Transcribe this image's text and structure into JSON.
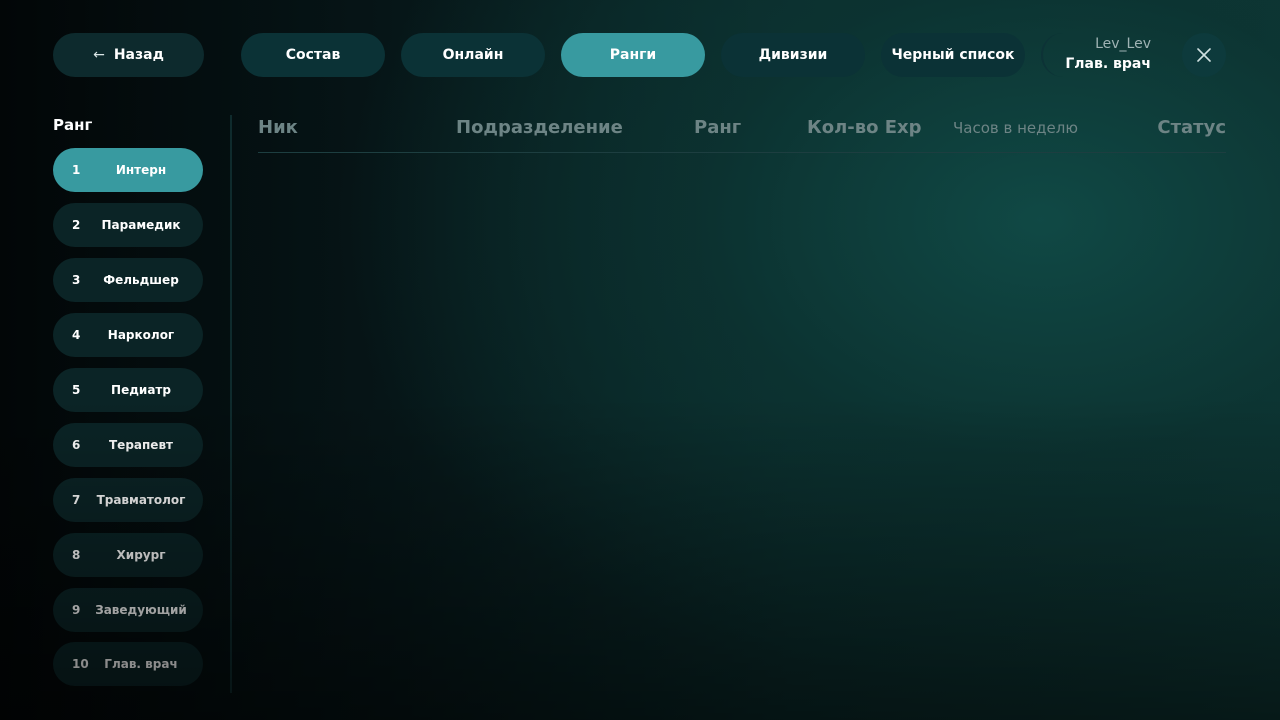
{
  "header": {
    "back_label": "Назад",
    "tabs": [
      {
        "label": "Состав",
        "active": false
      },
      {
        "label": "Онлайн",
        "active": false
      },
      {
        "label": "Ранги",
        "active": true
      },
      {
        "label": "Дивизии",
        "active": false
      },
      {
        "label": "Черный список",
        "active": false
      }
    ],
    "user": {
      "name": "Lev_Lev",
      "rank": "Глав. врач"
    }
  },
  "sidebar": {
    "title": "Ранг",
    "items": [
      {
        "num": "1",
        "label": "Интерн",
        "active": true
      },
      {
        "num": "2",
        "label": "Парамедик",
        "active": false
      },
      {
        "num": "3",
        "label": "Фельдшер",
        "active": false
      },
      {
        "num": "4",
        "label": "Нарколог",
        "active": false
      },
      {
        "num": "5",
        "label": "Педиатр",
        "active": false
      },
      {
        "num": "6",
        "label": "Терапевт",
        "active": false
      },
      {
        "num": "7",
        "label": "Травматолог",
        "active": false
      },
      {
        "num": "8",
        "label": "Хирург",
        "active": false
      },
      {
        "num": "9",
        "label": "Заведующий",
        "active": false
      },
      {
        "num": "10",
        "label": "Глав. врач",
        "active": false
      }
    ]
  },
  "table": {
    "columns": [
      "Ник",
      "Подразделение",
      "Ранг",
      "Кол-во Exp",
      "Часов в неделю",
      "Статус"
    ],
    "rows": []
  },
  "colors": {
    "accent": "#389aa0",
    "pill": "#0b3236",
    "muted_text": "#6d8485"
  },
  "icons": {
    "back": "arrow-left-icon",
    "close": "close-icon"
  }
}
